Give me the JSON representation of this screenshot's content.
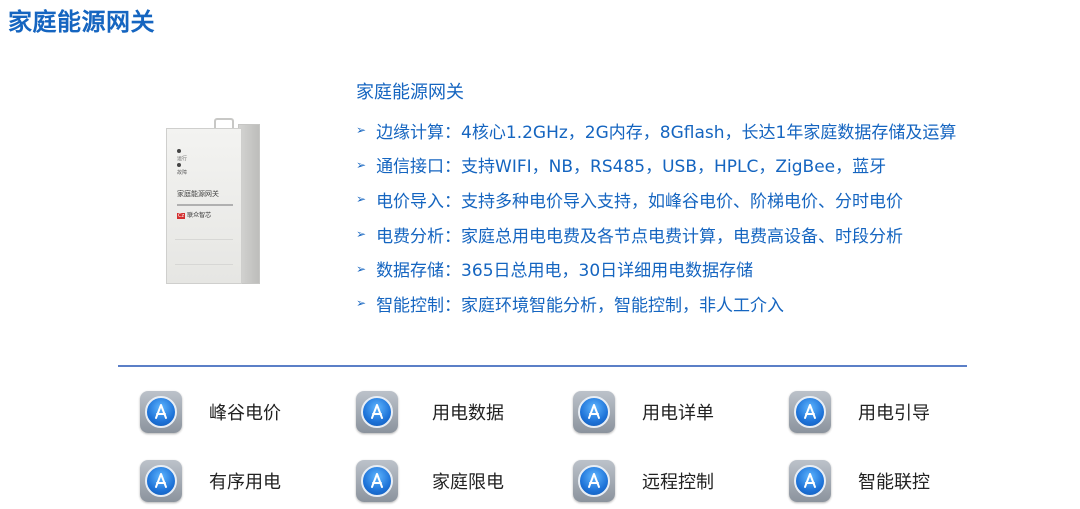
{
  "page": {
    "title": "家庭能源网关"
  },
  "device": {
    "led1": "运行",
    "led2": "故障",
    "name": "家庭能源网关",
    "brand_logo": "Cz",
    "brand": "联众智芯"
  },
  "features": {
    "title": "家庭能源网关",
    "bullet": "➢",
    "items": [
      {
        "label": "边缘计算：4核心1.2GHz，2G内存，8Gflash，长达1年家庭数据存储及运算"
      },
      {
        "label": "通信接口：支持WIFI，NB，RS485，USB，HPLC，ZigBee，蓝牙"
      },
      {
        "label": "电价导入：支持多种电价导入支持，如峰谷电价、阶梯电价、分时电价"
      },
      {
        "label": "电费分析：家庭总用电电费及各节点电费计算，电费高设备、时段分析"
      },
      {
        "label": "数据存储：365日总用电，30日详细用电数据存储"
      },
      {
        "label": "智能控制：家庭环境智能分析，智能控制，非人工介入"
      }
    ]
  },
  "apps": {
    "icon": "app-store-icon",
    "items": [
      {
        "label": "峰谷电价"
      },
      {
        "label": "用电数据"
      },
      {
        "label": "用电详单"
      },
      {
        "label": "用电引导"
      },
      {
        "label": "有序用电"
      },
      {
        "label": "家庭限电"
      },
      {
        "label": "远程控制"
      },
      {
        "label": "智能联控"
      }
    ]
  }
}
